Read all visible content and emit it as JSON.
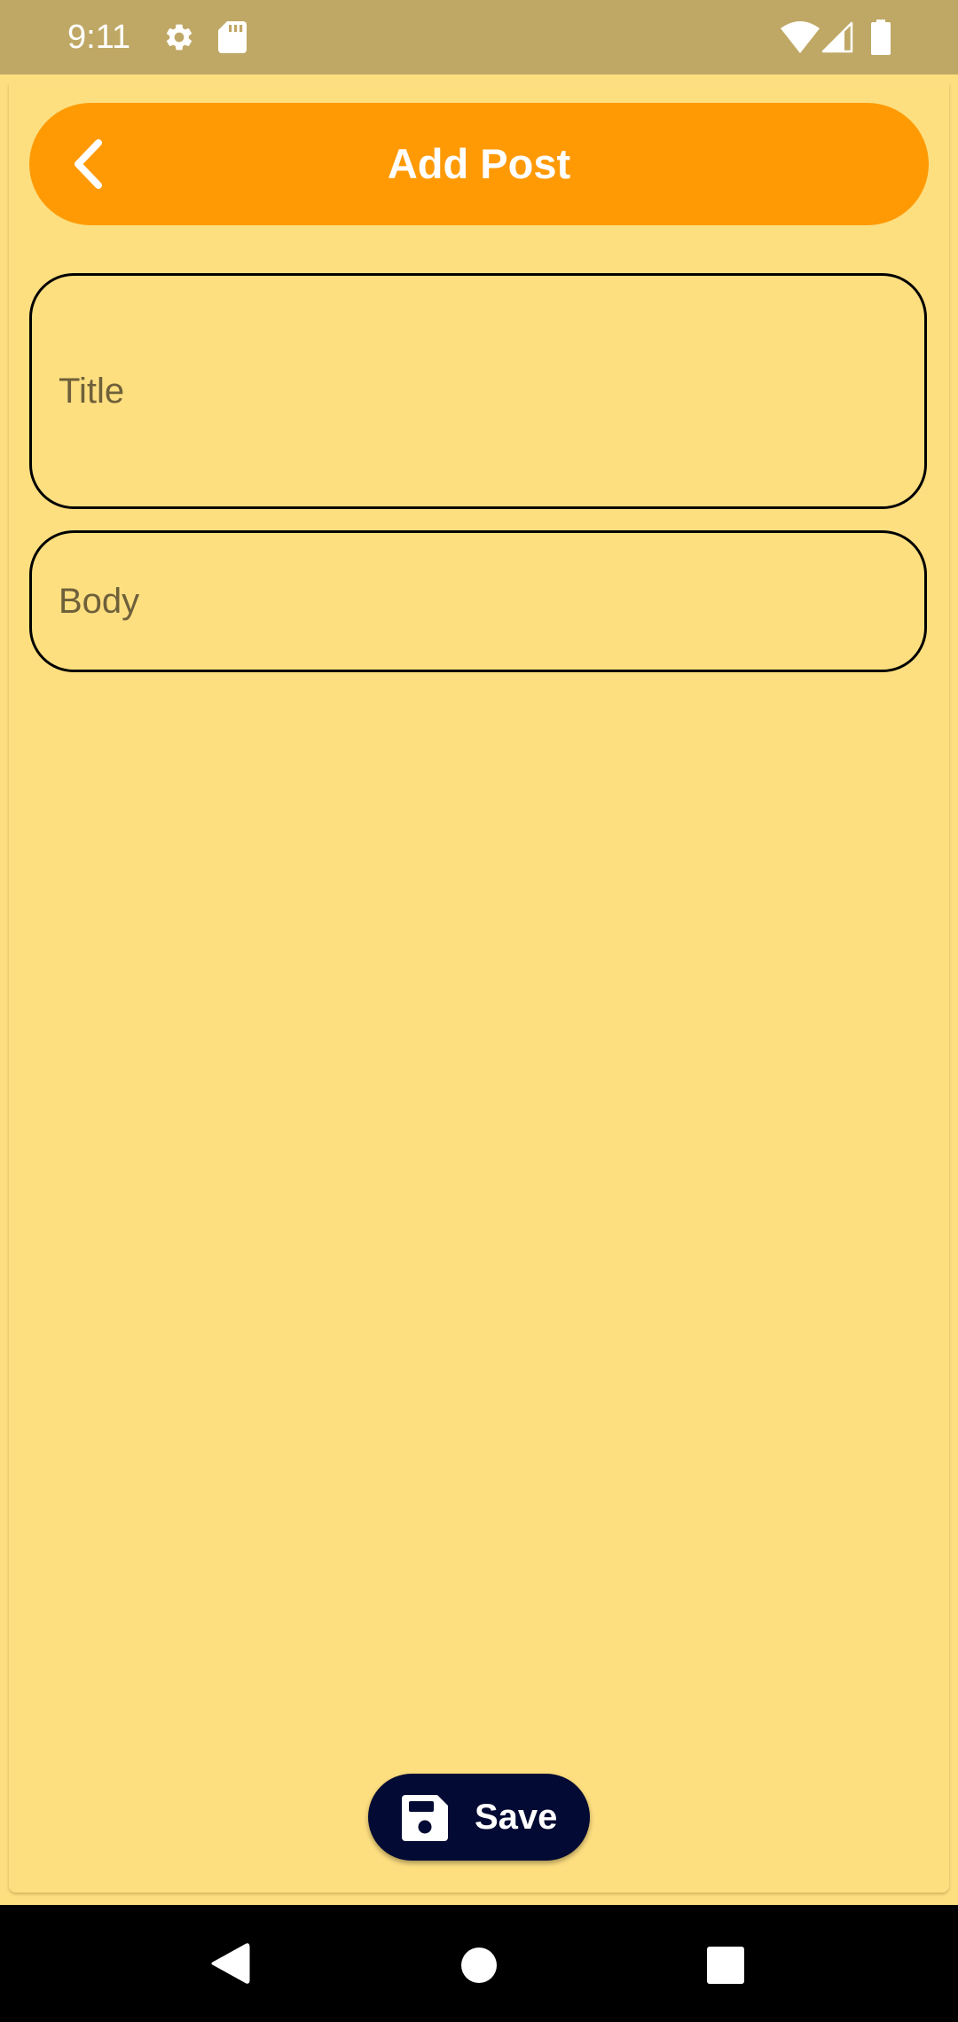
{
  "status_bar": {
    "time": "9:11",
    "left_icons": [
      "gear-icon",
      "sd-card-icon"
    ],
    "right_icons": [
      "wifi-icon",
      "cellular-signal-icon",
      "battery-icon"
    ]
  },
  "header": {
    "title": "Add Post",
    "back_icon": "chevron-left-icon"
  },
  "form": {
    "title_placeholder": "Title",
    "title_value": "",
    "body_placeholder": "Body",
    "body_value": ""
  },
  "actions": {
    "save_label": "Save",
    "save_icon": "floppy-disk-icon"
  },
  "navigation": {
    "buttons": [
      "back-triangle-icon",
      "home-circle-icon",
      "recents-square-icon"
    ]
  },
  "colors": {
    "status_bar": "#BFA865",
    "background": "#FEDF80",
    "header": "#FF9A05",
    "save_button": "#030A33",
    "nav_bar": "#000000"
  }
}
